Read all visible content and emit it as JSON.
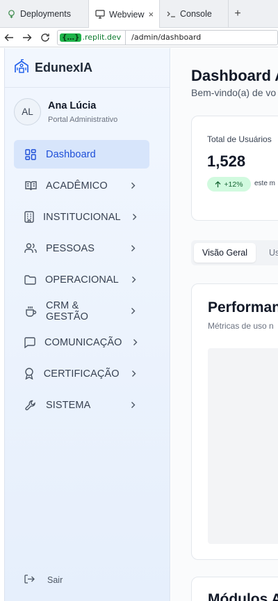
{
  "browser": {
    "tabs": [
      {
        "label": "Deployments",
        "icon": "deployments-icon"
      },
      {
        "label": "Webview",
        "icon": "webview-icon",
        "close": "×"
      },
      {
        "label": "Console",
        "icon": "console-icon"
      }
    ],
    "new_tab": "+",
    "url_host_mask": "{…}",
    "url_host": ".replit.dev",
    "url_path": "/admin/dashboard"
  },
  "sidebar": {
    "brand": "EdunexIA",
    "user": {
      "initials": "AL",
      "name": "Ana Lúcia",
      "role": "Portal Administrativo"
    },
    "items": [
      {
        "label": "Dashboard",
        "icon": "dashboard-icon",
        "active": true
      },
      {
        "label": "ACADÊMICO",
        "icon": "book-icon"
      },
      {
        "label": "INSTITUCIONAL",
        "icon": "building-icon"
      },
      {
        "label": "PESSOAS",
        "icon": "users-icon"
      },
      {
        "label": "OPERACIONAL",
        "icon": "folder-icon"
      },
      {
        "label": "CRM & GESTÃO",
        "icon": "coffee-icon"
      },
      {
        "label": "COMUNICAÇÃO",
        "icon": "message-icon"
      },
      {
        "label": "CERTIFICAÇÃO",
        "icon": "award-icon"
      },
      {
        "label": "SISTEMA",
        "icon": "wrench-icon"
      }
    ],
    "logout": "Sair"
  },
  "main": {
    "title": "Dashboard A",
    "subtitle": "Bem-vindo(a) de vo",
    "stat": {
      "label": "Total de Usuários",
      "value": "1,528",
      "change": "+12%",
      "note": "este m"
    },
    "tabs": [
      "Visão Geral",
      "Us"
    ],
    "performance": {
      "title": "Performan",
      "subtitle": "Métricas de uso n"
    },
    "modules": {
      "title": "Módulos A"
    }
  },
  "colors": {
    "accent": "#1d4ed8",
    "active_bg": "#d7e5fb",
    "badge_bg": "#d1fadf"
  }
}
